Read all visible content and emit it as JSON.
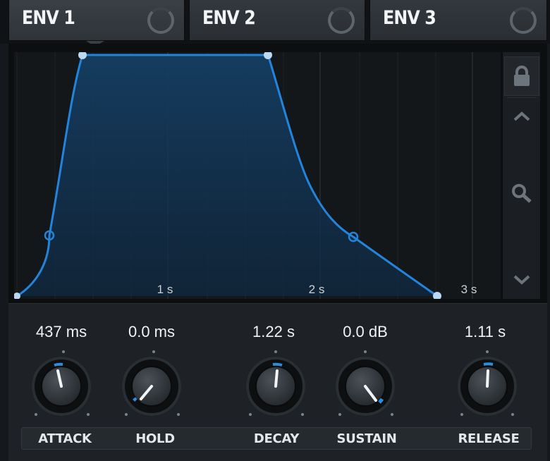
{
  "tabs": [
    {
      "label": "ENV 1",
      "active": true
    },
    {
      "label": "ENV 2",
      "active": false
    },
    {
      "label": "ENV 3",
      "active": false
    }
  ],
  "graph": {
    "time_labels": [
      "1 s",
      "2 s",
      "3 s"
    ],
    "curve_color": "#1f7ed6",
    "fill_color": "#123a5e"
  },
  "side_panel": {
    "icons": [
      "lock-icon",
      "chevron-up-icon",
      "zoom-icon",
      "chevron-down-icon"
    ]
  },
  "knobs": [
    {
      "id": "attack",
      "label": "ATTACK",
      "value": "437 ms"
    },
    {
      "id": "hold",
      "label": "HOLD",
      "value": "0.0 ms"
    },
    {
      "id": "decay",
      "label": "DECAY",
      "value": "1.22 s"
    },
    {
      "id": "sustain",
      "label": "SUSTAIN",
      "value": "0.0 dB"
    },
    {
      "id": "release",
      "label": "RELEASE",
      "value": "1.11 s"
    }
  ],
  "accent_color": "#2a8de0"
}
